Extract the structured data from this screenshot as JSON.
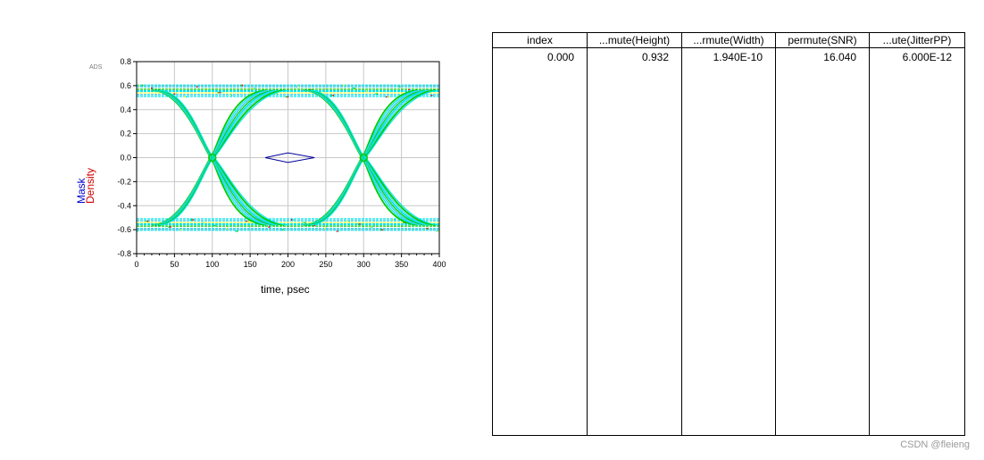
{
  "plot": {
    "ads_tag": "ADS",
    "ylabel_lines": [
      "Mask",
      "Density"
    ],
    "xlabel": "time, psec"
  },
  "chart_data": {
    "type": "scatter",
    "title": "",
    "xlabel": "time, psec",
    "ylabel": "Mask / Density",
    "xlim": [
      0,
      400
    ],
    "ylim": [
      -0.8,
      0.8
    ],
    "x_ticks": [
      0,
      50,
      100,
      150,
      200,
      250,
      300,
      350,
      400
    ],
    "y_ticks": [
      0.8,
      0.6,
      0.4,
      0.2,
      0.0,
      -0.2,
      -0.4,
      -0.6,
      -0.8
    ],
    "x_tick_labels": [
      "0",
      "50",
      "100",
      "150",
      "200",
      "250",
      "300",
      "350",
      "400"
    ],
    "y_tick_labels": [
      "0.8",
      "0.6",
      "0.4",
      "0.2",
      "0.0",
      "-0.2",
      "-0.4",
      "-0.6",
      "-0.8"
    ],
    "grid": true,
    "series": [
      {
        "name": "Mask",
        "color": "#000099",
        "x": [
          170,
          200,
          235,
          200,
          170
        ],
        "y": [
          0.0,
          0.04,
          0.0,
          -0.04,
          0.0
        ]
      }
    ],
    "eye_diagram": {
      "levels": [
        0.56,
        -0.56
      ],
      "crossings_x": [
        100,
        300
      ],
      "crossing_y": 0.0,
      "density_colors": [
        "#00e5ee",
        "#3ed6f0",
        "#00cc00",
        "#ffff00",
        "#ff0000"
      ]
    }
  },
  "table": {
    "columns": [
      "index",
      "...mute(Height)",
      "...rmute(Width)",
      "permute(SNR)",
      "...ute(JitterPP)"
    ],
    "rows": [
      [
        "0.000",
        "0.932",
        "1.940E-10",
        "16.040",
        "6.000E-12"
      ]
    ]
  },
  "watermark": "CSDN @fleieng"
}
